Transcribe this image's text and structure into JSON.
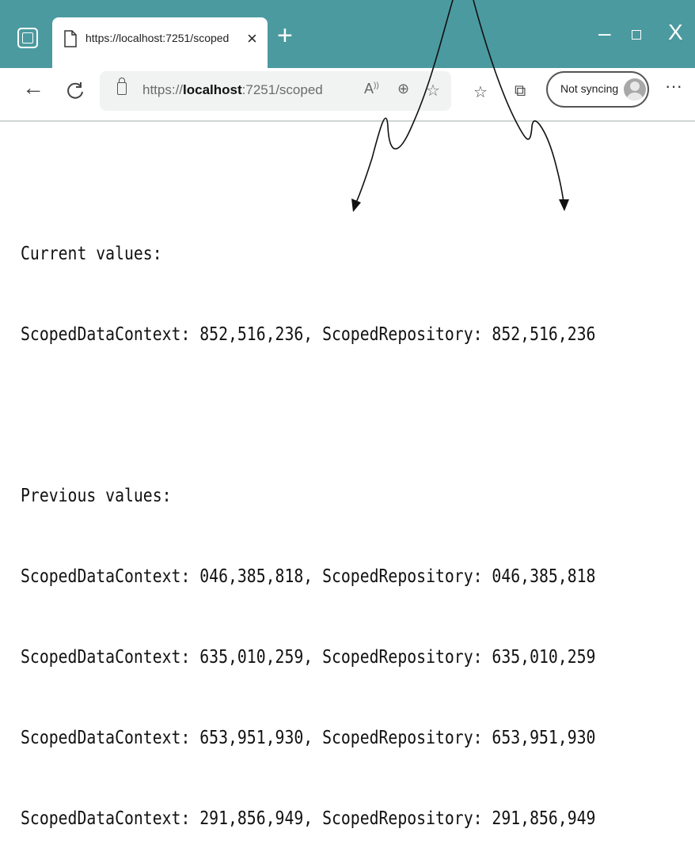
{
  "browser": {
    "tab": {
      "title": "https://localhost:7251/scoped",
      "close_glyph": "×"
    },
    "new_tab_glyph": "+",
    "window_controls": {
      "minimize": "–",
      "maximize": "",
      "close": "X"
    },
    "address": {
      "scheme": "https://",
      "host": "localhost",
      "rest": ":7251/scoped"
    },
    "sync_label": "Not syncing",
    "more_glyph": "···",
    "icons": [
      "tab-actions-icon",
      "page-icon",
      "back-arrow-icon",
      "refresh-icon",
      "lock-icon",
      "read-aloud-icon",
      "zoom-icon",
      "add-favorite-icon",
      "favorites-icon",
      "collections-icon",
      "profile-avatar-icon"
    ]
  },
  "page": {
    "current_heading": "Current values:",
    "current_line": "ScopedDataContext: 852,516,236, ScopedRepository: 852,516,236",
    "previous_heading": "Previous values:",
    "previous_lines": [
      "ScopedDataContext: 046,385,818, ScopedRepository: 046,385,818",
      "ScopedDataContext: 635,010,259, ScopedRepository: 635,010,259",
      "ScopedDataContext: 653,951,930, ScopedRepository: 653,951,930",
      "ScopedDataContext: 291,856,949, ScopedRepository: 291,856,949"
    ]
  },
  "colors": {
    "titlebar": "#4b9aa0",
    "toolbar_border": "#cfd5d6",
    "address_bg": "#f1f3f3"
  }
}
